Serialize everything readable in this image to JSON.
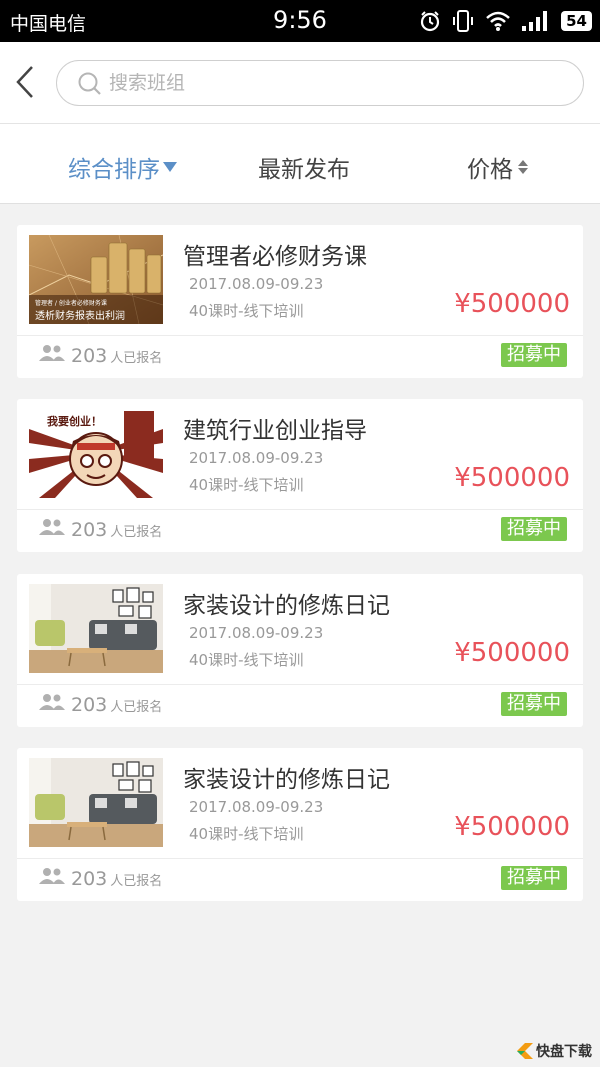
{
  "status_bar": {
    "carrier": "中国电信",
    "time": "9:56",
    "battery": "54"
  },
  "search": {
    "placeholder": "搜索班组"
  },
  "tabs": [
    {
      "label": "综合排序",
      "active": true
    },
    {
      "label": "最新发布",
      "active": false
    },
    {
      "label": "价格",
      "active": false
    }
  ],
  "courses": [
    {
      "title": "管理者必修财务课",
      "dates": "2017.08.09-09.23",
      "meta": "40课时-线下培训",
      "price": "¥500000",
      "enrolled": "203",
      "enrolled_label": "人已报名",
      "status": "招募中",
      "image": "finance-coins",
      "image_caption_small": "管理者 / 创业者必修财务课",
      "image_caption": "透析财务报表出利润"
    },
    {
      "title": "建筑行业创业指导",
      "dates": "2017.08.09-09.23",
      "meta": "40课时-线下培训",
      "price": "¥500000",
      "enrolled": "203",
      "enrolled_label": "人已报名",
      "status": "招募中",
      "image": "entrepreneur-cartoon",
      "image_caption": "我要创业！"
    },
    {
      "title": "家装设计的修炼日记",
      "dates": "2017.08.09-09.23",
      "meta": "40课时-线下培训",
      "price": "¥500000",
      "enrolled": "203",
      "enrolled_label": "人已报名",
      "status": "招募中",
      "image": "living-room"
    },
    {
      "title": "家装设计的修炼日记",
      "dates": "2017.08.09-09.23",
      "meta": "40课时-线下培训",
      "price": "¥500000",
      "enrolled": "203",
      "enrolled_label": "人已报名",
      "status": "招募中",
      "image": "living-room"
    }
  ],
  "watermark": {
    "text": "快盘下载"
  },
  "colors": {
    "accent": "#5b8fc7",
    "price": "#e8525a",
    "badge": "#7cc84e",
    "background": "#f2f2f2"
  }
}
